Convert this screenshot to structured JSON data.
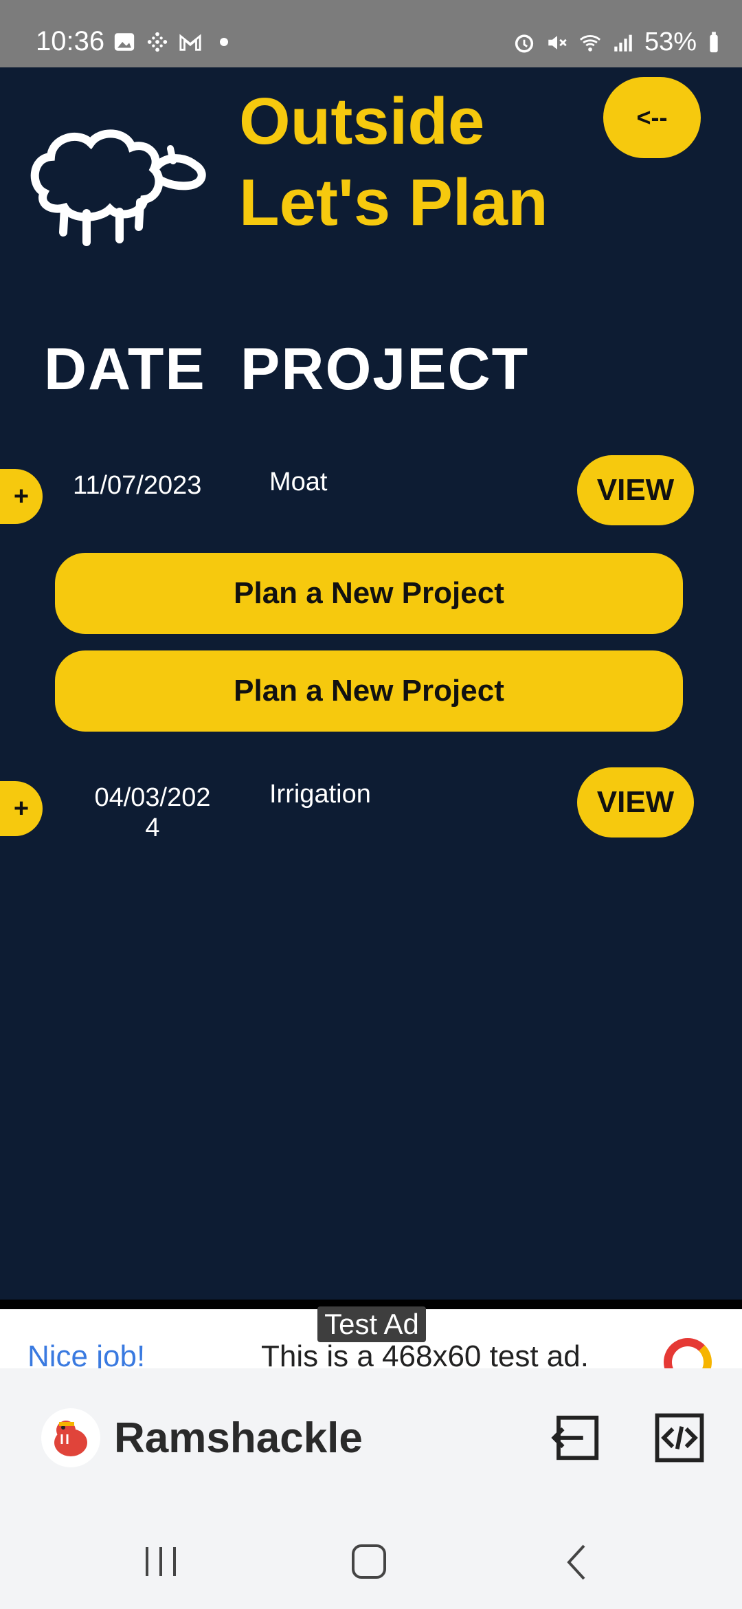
{
  "status": {
    "time": "10:36",
    "battery": "53%"
  },
  "header": {
    "title_line1": "Outside",
    "title_line2": "Let's Plan",
    "back_label": "<--"
  },
  "columns": {
    "date": "DATE",
    "project": "PROJECT"
  },
  "rows": [
    {
      "expand": "+",
      "date": "11/07/2023",
      "project": "Moat",
      "view_label": "VIEW"
    },
    {
      "expand": "+",
      "date": "04/03/202",
      "date_cont": "4",
      "project": "Irrigation",
      "view_label": "VIEW"
    }
  ],
  "actions": {
    "plan_new_1": "Plan a New Project",
    "plan_new_2": "Plan a New Project"
  },
  "ad": {
    "label": "Test Ad",
    "left_text": "Nice job!",
    "center_text": "This is a 468x60 test ad."
  },
  "footer": {
    "brand": "Ramshackle"
  },
  "colors": {
    "background": "#0d1c33",
    "accent": "#f6c90e"
  },
  "icons": {
    "logo": "sheep-icon",
    "back": "exit-icon",
    "code": "code-icon"
  }
}
